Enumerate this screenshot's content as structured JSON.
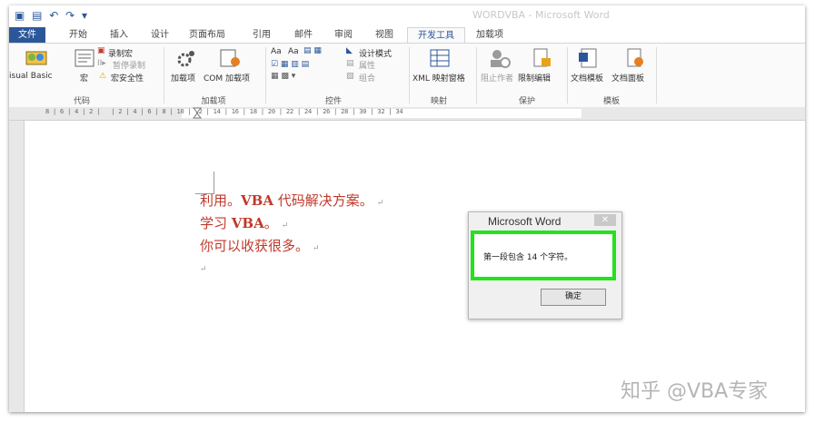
{
  "window": {
    "title": "WORDVBA - Microsoft Word"
  },
  "tabs": [
    "文件",
    "开始",
    "插入",
    "设计",
    "页面布局",
    "引用",
    "邮件",
    "审阅",
    "视图",
    "开发工具",
    "加载项"
  ],
  "ribbon": {
    "code": {
      "label": "代码",
      "visual_basic": "isual Basic",
      "macros": "宏",
      "record_macro": "录制宏",
      "pause_recording": "暂停录制",
      "macro_security": "宏安全性"
    },
    "addins": {
      "label": "加载项",
      "addins": "加载项",
      "com_addins": "COM 加载项"
    },
    "controls": {
      "label": "控件",
      "aa1": "Aa",
      "aa2": "Aa",
      "design_mode": "设计模式",
      "properties": "属性",
      "group": "组合"
    },
    "mapping": {
      "label": "映射",
      "xml_pane": "XML 映射窗格"
    },
    "protect": {
      "label": "保护",
      "block_authors": "阻止作者",
      "restrict_editing": "限制编辑"
    },
    "templates": {
      "label": "模板",
      "document_template": "文档模板",
      "document_panel": "文档面板"
    }
  },
  "ruler": {
    "text": "8 | 6 | 4 | 2 |   | 2 | 4 | 6 | 8 | 10 | 12 | 14 | 16 | 18 | 20 | 22 | 24 | 26 | 28 | 30 | 32 | 34"
  },
  "document": {
    "para1_a": "利用。",
    "para1_vba": "VBA",
    "para1_b": " 代码解决方案。",
    "para2_a": "学习 ",
    "para2_vba": "VBA",
    "para2_b": "。",
    "para3": "你可以收获很多。",
    "mark": "↵"
  },
  "dialog": {
    "title": "Microsoft Word",
    "close": "✕",
    "message": "第一段包含 14 个字符。",
    "ok": "确定"
  },
  "watermark": "知乎 @VBA专家",
  "colors": {
    "accent": "#2b579a",
    "doc_text": "#c0392b",
    "highlight": "#22e31c"
  }
}
